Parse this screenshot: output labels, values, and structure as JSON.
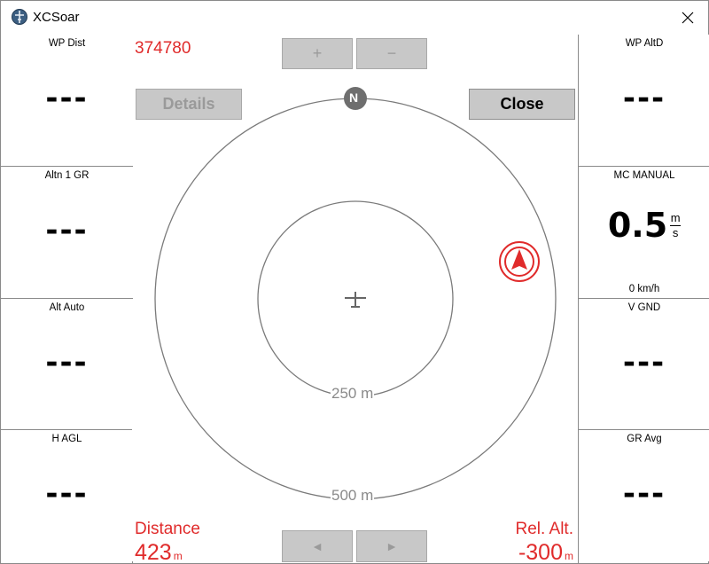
{
  "window": {
    "title": "XCSoar",
    "app_icon": "xcsoar-globe-icon",
    "close_icon": "close-icon"
  },
  "left_infoboxes": [
    {
      "title": "WP Dist",
      "value": "---"
    },
    {
      "title": "Altn 1 GR",
      "value": "---"
    },
    {
      "title": "Alt Auto",
      "value": "---"
    },
    {
      "title": "H AGL",
      "value": "---"
    }
  ],
  "right_infoboxes": [
    {
      "title": "WP AltD",
      "value": "---"
    },
    {
      "title": "MC MANUAL",
      "value": "0.5",
      "unit_top": "m",
      "unit_bottom": "s",
      "comment": "0 km/h"
    },
    {
      "title": "V GND",
      "value": "---"
    },
    {
      "title": "GR Avg",
      "value": "---"
    }
  ],
  "flarm": {
    "target_id": "374780",
    "zoom_in_label": "+",
    "zoom_out_label": "−",
    "details_label": "Details",
    "close_label": "Close",
    "north_label": "N",
    "ring_inner_label": "250 m",
    "ring_outer_label": "500 m",
    "distance_label": "Distance",
    "distance_value": "423",
    "distance_unit": "m",
    "rel_alt_label": "Rel. Alt.",
    "rel_alt_value": "-300",
    "rel_alt_unit": "m",
    "prev_label": "◄",
    "next_label": "►"
  },
  "colors": {
    "accent_red": "#e02b2b",
    "grey": "#8a8a8a",
    "button": "#c8c8c8"
  }
}
